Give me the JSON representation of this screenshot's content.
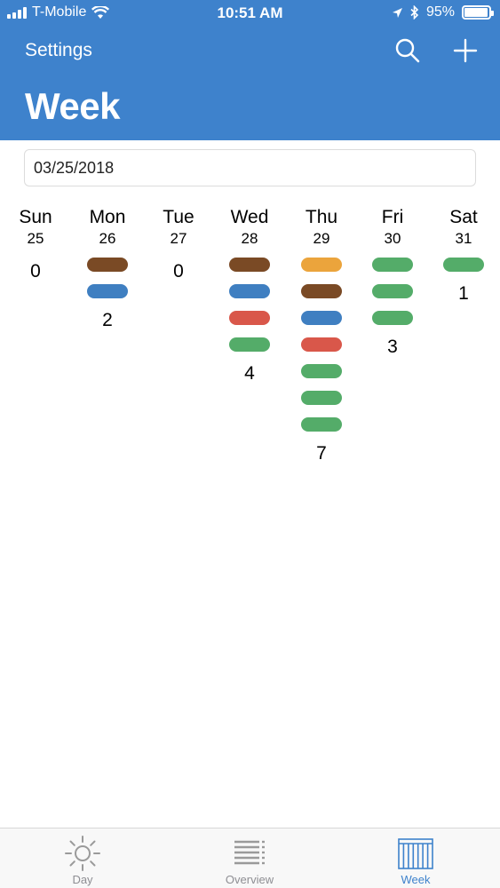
{
  "status_bar": {
    "carrier": "T-Mobile",
    "time": "10:51 AM",
    "battery": "95%",
    "battery_level": 0.95
  },
  "nav": {
    "back_label": "Settings",
    "title": "Week"
  },
  "date_field": {
    "value": "03/25/2018"
  },
  "colors": {
    "header": "#3e82cc",
    "brown": "#7a4a25",
    "blue": "#3f7fc1",
    "red": "#d9574a",
    "green": "#54ac69",
    "orange": "#eba43c"
  },
  "week": {
    "days": [
      {
        "name": "Sun",
        "date": "25",
        "count": "0",
        "bars": []
      },
      {
        "name": "Mon",
        "date": "26",
        "count": "2",
        "bars": [
          "brown",
          "blue"
        ]
      },
      {
        "name": "Tue",
        "date": "27",
        "count": "0",
        "bars": []
      },
      {
        "name": "Wed",
        "date": "28",
        "count": "4",
        "bars": [
          "brown",
          "blue",
          "red",
          "green"
        ]
      },
      {
        "name": "Thu",
        "date": "29",
        "count": "7",
        "bars": [
          "orange",
          "brown",
          "blue",
          "red",
          "green",
          "green",
          "green"
        ]
      },
      {
        "name": "Fri",
        "date": "30",
        "count": "3",
        "bars": [
          "green",
          "green",
          "green"
        ]
      },
      {
        "name": "Sat",
        "date": "31",
        "count": "1",
        "bars": [
          "green"
        ]
      }
    ]
  },
  "tabbar": {
    "tabs": [
      {
        "label": "Day",
        "icon": "sun-icon",
        "active": false
      },
      {
        "label": "Overview",
        "icon": "list-icon",
        "active": false
      },
      {
        "label": "Week",
        "icon": "calendar-grid-icon",
        "active": true
      }
    ]
  }
}
